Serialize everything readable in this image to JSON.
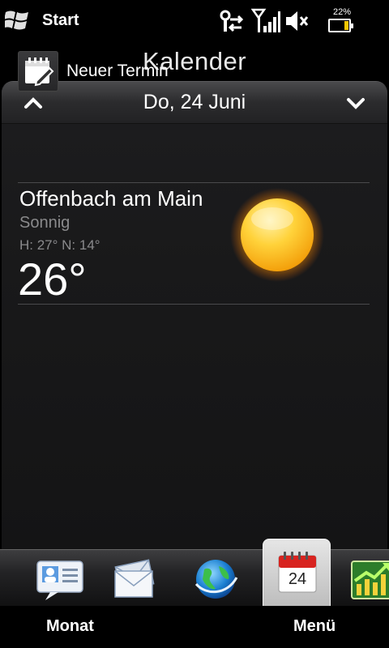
{
  "status_bar": {
    "start_label": "Start",
    "battery_percent": "22%",
    "battery_level": 0.22,
    "icons": [
      "connectivity-icon",
      "signal-icon",
      "speaker-muted-icon",
      "battery-icon"
    ]
  },
  "header": {
    "title": "Kalender"
  },
  "date_bar": {
    "date": "Do, 24 Juni",
    "prev_icon": "chevron-up-icon",
    "next_icon": "chevron-down-icon"
  },
  "new_appointment": {
    "label": "Neuer Termin",
    "icon": "calendar-edit-icon"
  },
  "weather": {
    "city": "Offenbach am Main",
    "condition": "Sonnig",
    "hi_lo": "H: 27° N: 14°",
    "temperature": "26°",
    "icon": "sun-icon"
  },
  "dock": {
    "items": [
      "contacts-icon",
      "mail-icon",
      "internet-icon",
      "calendar-icon",
      "stocks-icon"
    ],
    "selected_calendar_day": "24"
  },
  "softkeys": {
    "left": "Monat",
    "right": "Menü"
  },
  "colors": {
    "accent_sun": "#f7b21d",
    "calendar_red": "#d8231f",
    "battery_yellow": "#f7c600"
  }
}
